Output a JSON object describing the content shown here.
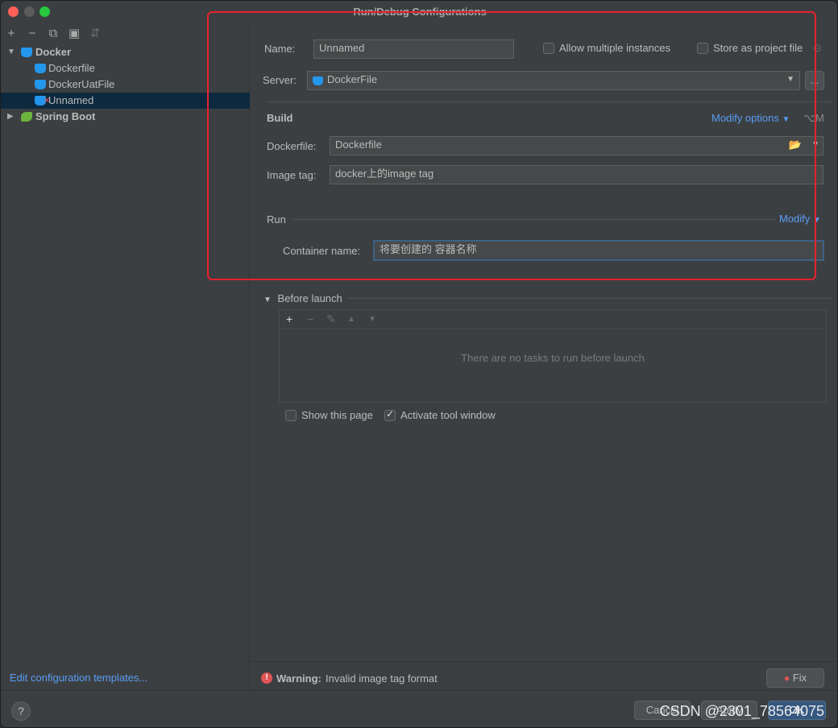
{
  "window": {
    "title": "Run/Debug Configurations"
  },
  "sidebar": {
    "toolbar": [
      "+",
      "−",
      "⧉",
      "▣",
      "⇵"
    ],
    "tree": [
      {
        "label": "Docker",
        "level": 0,
        "expanded": true,
        "bold": true
      },
      {
        "label": "Dockerfile",
        "level": 1
      },
      {
        "label": "DockerUatFile",
        "level": 1
      },
      {
        "label": "Unnamed",
        "level": 1,
        "selected": true,
        "error": true
      },
      {
        "label": "Spring Boot",
        "level": 0,
        "expanded": false,
        "bold": true
      }
    ],
    "edit_templates": "Edit configuration templates..."
  },
  "form": {
    "name_label": "Name:",
    "name_value": "Unnamed",
    "allow_multiple": "Allow multiple instances",
    "store_as_project": "Store as project file",
    "server_label": "Server:",
    "server_value": "DockerFile",
    "server_more": "...",
    "build_header": "Build",
    "modify_options": "Modify options",
    "modify_shortcut": "⌥M",
    "dockerfile_label": "Dockerfile:",
    "dockerfile_value": "Dockerfile",
    "image_tag_label": "Image tag:",
    "image_tag_value": "docker上的image tag",
    "run_header": "Run",
    "run_modify": "Modify",
    "container_label": "Container name:",
    "container_value": "将要创建的 容器名称"
  },
  "before_launch": {
    "title": "Before launch",
    "empty": "There are no tasks to run before launch",
    "show_page": "Show this page",
    "activate_tool": "Activate tool window"
  },
  "warning": {
    "label": "Warning:",
    "message": "Invalid image tag format",
    "fix": "Fix"
  },
  "bottom": {
    "help": "?",
    "cancel": "Cancel",
    "apply": "Apply",
    "ok": "OK"
  },
  "watermark": "CSDN @2301_78564075",
  "colors": {
    "accent_link": "#589df6",
    "highlight": "#e8212b",
    "docker": "#2396ed",
    "spring": "#6db33f"
  }
}
